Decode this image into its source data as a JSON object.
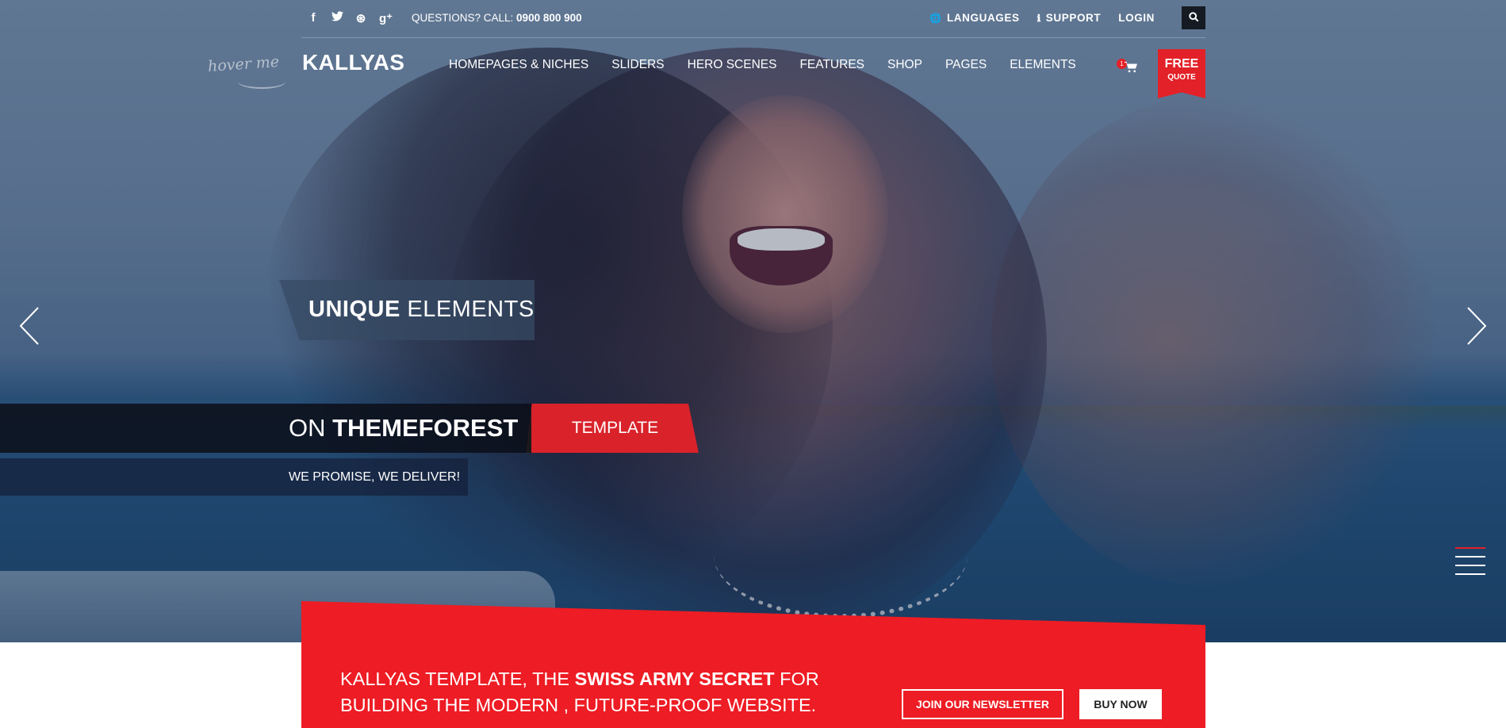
{
  "topbar": {
    "social_icons": [
      "facebook-icon",
      "twitter-icon",
      "dribbble-icon",
      "google-plus-icon"
    ],
    "social_glyphs": [
      "f",
      "🐦",
      "⊛",
      "g⁺"
    ],
    "phone_prefix": "QUESTIONS? CALL: ",
    "phone_number": "0900 800 900",
    "languages": "LANGUAGES",
    "support": "SUPPORT",
    "login": "LOGIN"
  },
  "nav": {
    "hover_hint": "hover me",
    "logo": "KALLYAS",
    "items": [
      "HOMEPAGES & NICHES",
      "SLIDERS",
      "HERO SCENES",
      "FEATURES",
      "SHOP",
      "PAGES",
      "ELEMENTS"
    ],
    "cart_count": "1",
    "free_quote_top": "FREE",
    "free_quote_bottom": "QUOTE"
  },
  "slide": {
    "caption1_bold": "UNIQUE",
    "caption1_rest": " ELEMENTS",
    "caption2_prefix": "ON ",
    "caption2_bold": "THEMEFOREST",
    "template_button": "TEMPLATE",
    "caption3": "WE PROMISE, WE DELIVER!"
  },
  "promo": {
    "line1_prefix": "KALLYAS TEMPLATE, THE ",
    "line1_bold": "SWISS ARMY SECRET",
    "line1_suffix": " FOR",
    "line2": "BUILDING THE MODERN , FUTURE-PROOF WEBSITE.",
    "newsletter_button": "JOIN OUR NEWSLETTER",
    "buy_button": "BUY NOW"
  },
  "colors": {
    "accent_red": "#ee1c24",
    "dark": "#151b23"
  }
}
